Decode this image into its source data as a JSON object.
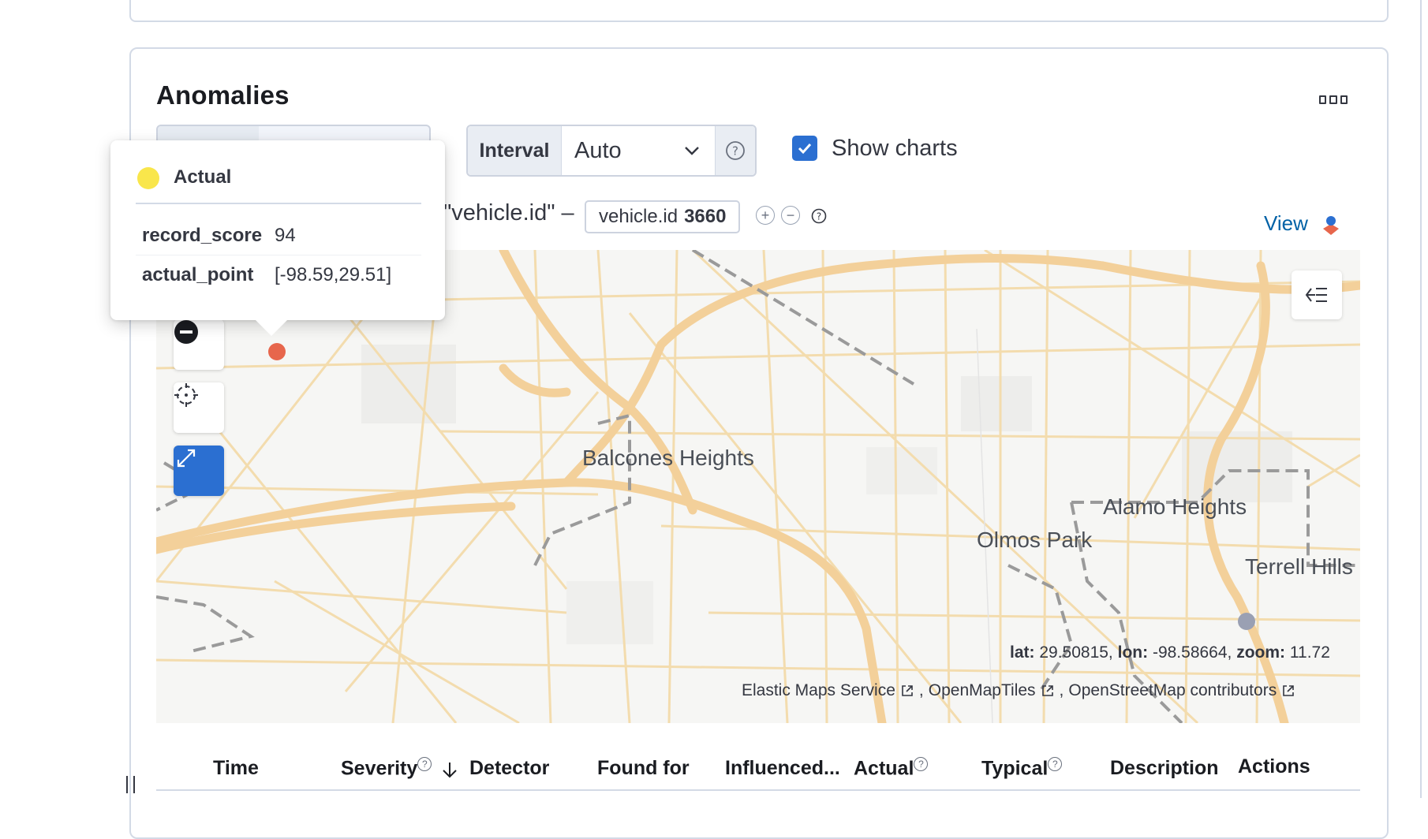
{
  "panel": {
    "title": "Anomalies",
    "more_icon": "ellipsis-icon"
  },
  "controls": {
    "interval_label": "Interval",
    "interval_value": "Auto",
    "show_charts_label": "Show charts",
    "show_charts_checked": true
  },
  "chart_header": {
    "title_fragment": "\"vehicle.id\" –",
    "badge_field": "vehicle.id",
    "badge_value": "3660",
    "view_label": "View"
  },
  "tooltip": {
    "series": "Actual",
    "series_color": "#f9e64b",
    "rows": [
      {
        "key": "record_score",
        "value": "94"
      },
      {
        "key": "actual_point",
        "value": "[-98.59,29.51]"
      }
    ]
  },
  "map": {
    "places": [
      "Balcones Heights",
      "Alamo Heights",
      "Olmos Park",
      "Terrell Hills"
    ],
    "coords": {
      "lat_label": "lat:",
      "lat": "29.50815,",
      "lon_label": "lon:",
      "lon": "-98.58664,",
      "zoom_label": "zoom:",
      "zoom": "11.72"
    },
    "attribution": [
      "Elastic Maps Service",
      "OpenMapTiles",
      "OpenStreetMap contributors"
    ],
    "anomaly_color": "#e7664c"
  },
  "table": {
    "columns": [
      "Time",
      "Severity",
      "Detector",
      "Found for",
      "Influenced...",
      "Actual",
      "Typical",
      "Description",
      "Actions"
    ]
  }
}
